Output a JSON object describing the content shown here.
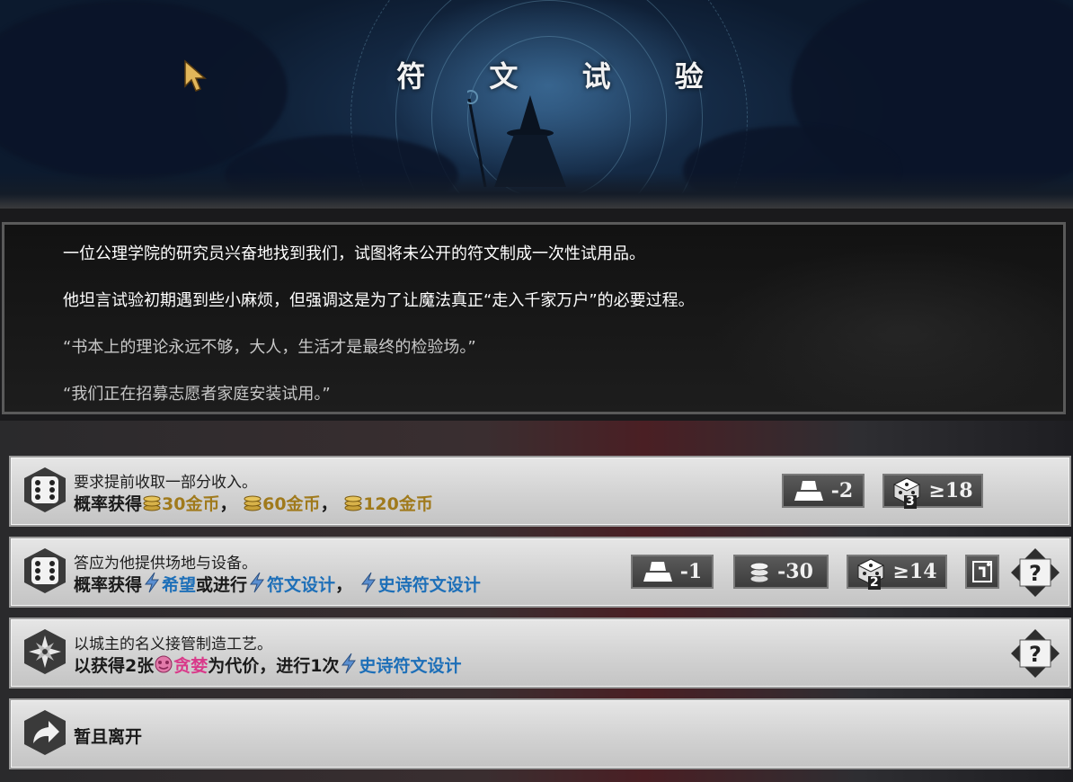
{
  "title": "符 文 试 验",
  "description": {
    "line1": "一位公理学院的研究员兴奋地找到我们，试图将未公开的符文制成一次性试用品。",
    "line2": "他坦言试验初期遇到些小麻烦，但强调这是为了让魔法真正“走入千家万户”的必要过程。",
    "line3": "“书本上的理论永远不够，大人，生活才是最终的检验场。”",
    "line4": "“我们正在招募志愿者家庭安装试用。”"
  },
  "options": [
    {
      "icon": "dice-icon",
      "text1": "要求提前收取一部分收入。",
      "prefix": "概率获得",
      "rewards": [
        "30金币",
        "60金币",
        "120金币"
      ],
      "sep": "，",
      "badges": [
        {
          "icon": "anvil-icon",
          "value": "-2"
        },
        {
          "icon": "dice-icon",
          "dice_count": "3",
          "value": "≥18"
        }
      ]
    },
    {
      "icon": "dice-icon",
      "text1": "答应为他提供场地与设备。",
      "prefix": "概率获得",
      "reward1": "希望",
      "mid": "或进行",
      "reward2": "符文设计",
      "sep": "，",
      "reward3": "史诗符文设计",
      "badges": [
        {
          "icon": "anvil-icon",
          "value": "-1"
        },
        {
          "icon": "coin-stack-icon",
          "value": "-30"
        },
        {
          "icon": "dice-icon",
          "dice_count": "2",
          "value": "≥14"
        }
      ],
      "has_card_button": true,
      "has_help_button": true
    },
    {
      "icon": "shuriken-icon",
      "text1": "以城主的名义接管制造工艺。",
      "prefix": "以获得2张",
      "cost": "贪婪",
      "mid": "为代价，进行1次",
      "reward": "史诗符文设计",
      "has_help_button": true
    },
    {
      "icon": "leave-arrow-icon",
      "label": "暂且离开"
    }
  ],
  "help_label": "?",
  "colors": {
    "gold": "#a07a1c",
    "blue": "#1d6fb8",
    "pink": "#d93a8a"
  }
}
